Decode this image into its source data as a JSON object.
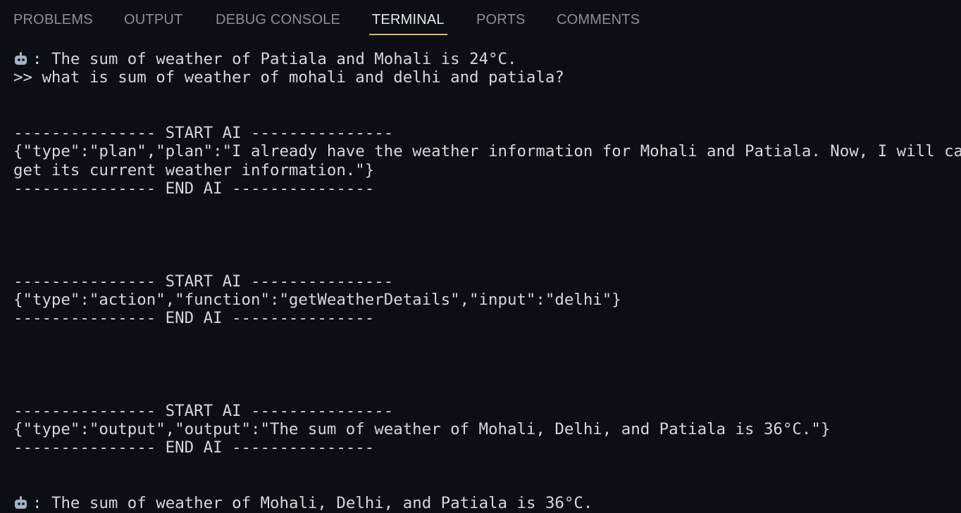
{
  "tabs": [
    {
      "label": "PROBLEMS"
    },
    {
      "label": "OUTPUT"
    },
    {
      "label": "DEBUG CONSOLE"
    },
    {
      "label": "TERMINAL",
      "active": true
    },
    {
      "label": "PORTS"
    },
    {
      "label": "COMMENTS"
    }
  ],
  "colors": {
    "background": "#0b0e14",
    "text": "#d4d7dc",
    "tab_inactive": "#8b8f97",
    "tab_active": "#e6e8eb",
    "tab_indicator": "#e8b66a"
  },
  "terminal": {
    "lines": [
      {
        "icon": "robot-icon",
        "text": ": The sum of weather of Patiala and Mohali is 24°C."
      },
      {
        "text": ">> what is sum of weather of mohali and delhi and patiala?"
      },
      {
        "text": ""
      },
      {
        "text": ""
      },
      {
        "text": "--------------- START AI ---------------"
      },
      {
        "text": "{\"type\":\"plan\",\"plan\":\"I already have the weather information for Mohali and Patiala. Now, I will call"
      },
      {
        "text": "get its current weather information.\"}"
      },
      {
        "text": "--------------- END AI ---------------"
      },
      {
        "text": ""
      },
      {
        "text": ""
      },
      {
        "text": ""
      },
      {
        "text": ""
      },
      {
        "text": "--------------- START AI ---------------"
      },
      {
        "text": "{\"type\":\"action\",\"function\":\"getWeatherDetails\",\"input\":\"delhi\"}"
      },
      {
        "text": "--------------- END AI ---------------"
      },
      {
        "text": ""
      },
      {
        "text": ""
      },
      {
        "text": ""
      },
      {
        "text": ""
      },
      {
        "text": "--------------- START AI ---------------"
      },
      {
        "text": "{\"type\":\"output\",\"output\":\"The sum of weather of Mohali, Delhi, and Patiala is 36°C.\"}"
      },
      {
        "text": "--------------- END AI ---------------"
      },
      {
        "text": ""
      },
      {
        "text": ""
      },
      {
        "icon": "robot-icon",
        "text": ": The sum of weather of Mohali, Delhi, and Patiala is 36°C."
      }
    ]
  }
}
